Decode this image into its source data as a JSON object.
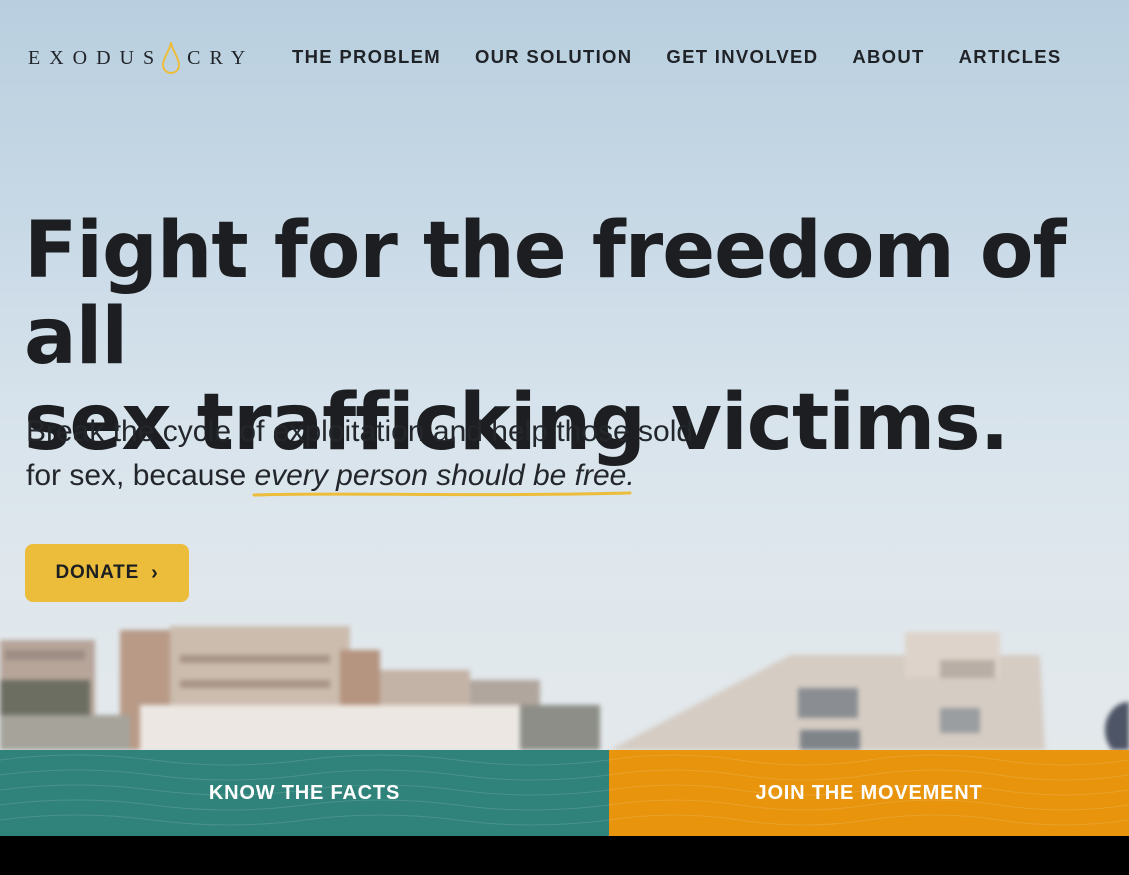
{
  "brand": {
    "logo_text_left": "EXODUS",
    "logo_text_right": "CRY",
    "accent_color": "#ecbd3a"
  },
  "nav": {
    "items": [
      {
        "label": "THE PROBLEM"
      },
      {
        "label": "OUR SOLUTION"
      },
      {
        "label": "GET INVOLVED"
      },
      {
        "label": "ABOUT"
      },
      {
        "label": "ARTICLES"
      }
    ]
  },
  "hero": {
    "headline_line1": "Fight for the freedom of all",
    "headline_line2": "sex trafficking victims.",
    "sub_line1": "Break the cycle of exploitation and help those sold",
    "sub_line2_prefix": "for sex, because ",
    "sub_emphasis": "every person should be free.",
    "donate_label": "DONATE",
    "donate_icon": "chevron-right-icon"
  },
  "cta": {
    "facts_label": "KNOW THE FACTS",
    "facts_color": "#2f837a",
    "movement_label": "JOIN THE MOVEMENT",
    "movement_color": "#e8940c"
  }
}
